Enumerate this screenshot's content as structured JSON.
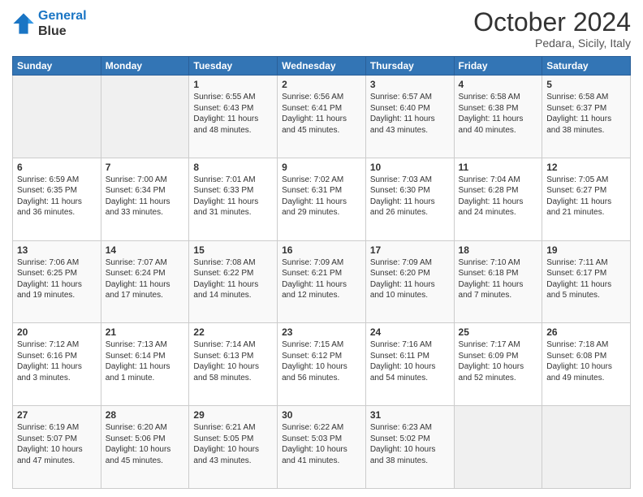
{
  "header": {
    "logo_line1": "General",
    "logo_line2": "Blue",
    "month": "October 2024",
    "location": "Pedara, Sicily, Italy"
  },
  "days_of_week": [
    "Sunday",
    "Monday",
    "Tuesday",
    "Wednesday",
    "Thursday",
    "Friday",
    "Saturday"
  ],
  "weeks": [
    [
      {
        "day": "",
        "content": ""
      },
      {
        "day": "",
        "content": ""
      },
      {
        "day": "1",
        "content": "Sunrise: 6:55 AM\nSunset: 6:43 PM\nDaylight: 11 hours\nand 48 minutes."
      },
      {
        "day": "2",
        "content": "Sunrise: 6:56 AM\nSunset: 6:41 PM\nDaylight: 11 hours\nand 45 minutes."
      },
      {
        "day": "3",
        "content": "Sunrise: 6:57 AM\nSunset: 6:40 PM\nDaylight: 11 hours\nand 43 minutes."
      },
      {
        "day": "4",
        "content": "Sunrise: 6:58 AM\nSunset: 6:38 PM\nDaylight: 11 hours\nand 40 minutes."
      },
      {
        "day": "5",
        "content": "Sunrise: 6:58 AM\nSunset: 6:37 PM\nDaylight: 11 hours\nand 38 minutes."
      }
    ],
    [
      {
        "day": "6",
        "content": "Sunrise: 6:59 AM\nSunset: 6:35 PM\nDaylight: 11 hours\nand 36 minutes."
      },
      {
        "day": "7",
        "content": "Sunrise: 7:00 AM\nSunset: 6:34 PM\nDaylight: 11 hours\nand 33 minutes."
      },
      {
        "day": "8",
        "content": "Sunrise: 7:01 AM\nSunset: 6:33 PM\nDaylight: 11 hours\nand 31 minutes."
      },
      {
        "day": "9",
        "content": "Sunrise: 7:02 AM\nSunset: 6:31 PM\nDaylight: 11 hours\nand 29 minutes."
      },
      {
        "day": "10",
        "content": "Sunrise: 7:03 AM\nSunset: 6:30 PM\nDaylight: 11 hours\nand 26 minutes."
      },
      {
        "day": "11",
        "content": "Sunrise: 7:04 AM\nSunset: 6:28 PM\nDaylight: 11 hours\nand 24 minutes."
      },
      {
        "day": "12",
        "content": "Sunrise: 7:05 AM\nSunset: 6:27 PM\nDaylight: 11 hours\nand 21 minutes."
      }
    ],
    [
      {
        "day": "13",
        "content": "Sunrise: 7:06 AM\nSunset: 6:25 PM\nDaylight: 11 hours\nand 19 minutes."
      },
      {
        "day": "14",
        "content": "Sunrise: 7:07 AM\nSunset: 6:24 PM\nDaylight: 11 hours\nand 17 minutes."
      },
      {
        "day": "15",
        "content": "Sunrise: 7:08 AM\nSunset: 6:22 PM\nDaylight: 11 hours\nand 14 minutes."
      },
      {
        "day": "16",
        "content": "Sunrise: 7:09 AM\nSunset: 6:21 PM\nDaylight: 11 hours\nand 12 minutes."
      },
      {
        "day": "17",
        "content": "Sunrise: 7:09 AM\nSunset: 6:20 PM\nDaylight: 11 hours\nand 10 minutes."
      },
      {
        "day": "18",
        "content": "Sunrise: 7:10 AM\nSunset: 6:18 PM\nDaylight: 11 hours\nand 7 minutes."
      },
      {
        "day": "19",
        "content": "Sunrise: 7:11 AM\nSunset: 6:17 PM\nDaylight: 11 hours\nand 5 minutes."
      }
    ],
    [
      {
        "day": "20",
        "content": "Sunrise: 7:12 AM\nSunset: 6:16 PM\nDaylight: 11 hours\nand 3 minutes."
      },
      {
        "day": "21",
        "content": "Sunrise: 7:13 AM\nSunset: 6:14 PM\nDaylight: 11 hours\nand 1 minute."
      },
      {
        "day": "22",
        "content": "Sunrise: 7:14 AM\nSunset: 6:13 PM\nDaylight: 10 hours\nand 58 minutes."
      },
      {
        "day": "23",
        "content": "Sunrise: 7:15 AM\nSunset: 6:12 PM\nDaylight: 10 hours\nand 56 minutes."
      },
      {
        "day": "24",
        "content": "Sunrise: 7:16 AM\nSunset: 6:11 PM\nDaylight: 10 hours\nand 54 minutes."
      },
      {
        "day": "25",
        "content": "Sunrise: 7:17 AM\nSunset: 6:09 PM\nDaylight: 10 hours\nand 52 minutes."
      },
      {
        "day": "26",
        "content": "Sunrise: 7:18 AM\nSunset: 6:08 PM\nDaylight: 10 hours\nand 49 minutes."
      }
    ],
    [
      {
        "day": "27",
        "content": "Sunrise: 6:19 AM\nSunset: 5:07 PM\nDaylight: 10 hours\nand 47 minutes."
      },
      {
        "day": "28",
        "content": "Sunrise: 6:20 AM\nSunset: 5:06 PM\nDaylight: 10 hours\nand 45 minutes."
      },
      {
        "day": "29",
        "content": "Sunrise: 6:21 AM\nSunset: 5:05 PM\nDaylight: 10 hours\nand 43 minutes."
      },
      {
        "day": "30",
        "content": "Sunrise: 6:22 AM\nSunset: 5:03 PM\nDaylight: 10 hours\nand 41 minutes."
      },
      {
        "day": "31",
        "content": "Sunrise: 6:23 AM\nSunset: 5:02 PM\nDaylight: 10 hours\nand 38 minutes."
      },
      {
        "day": "",
        "content": ""
      },
      {
        "day": "",
        "content": ""
      }
    ]
  ]
}
